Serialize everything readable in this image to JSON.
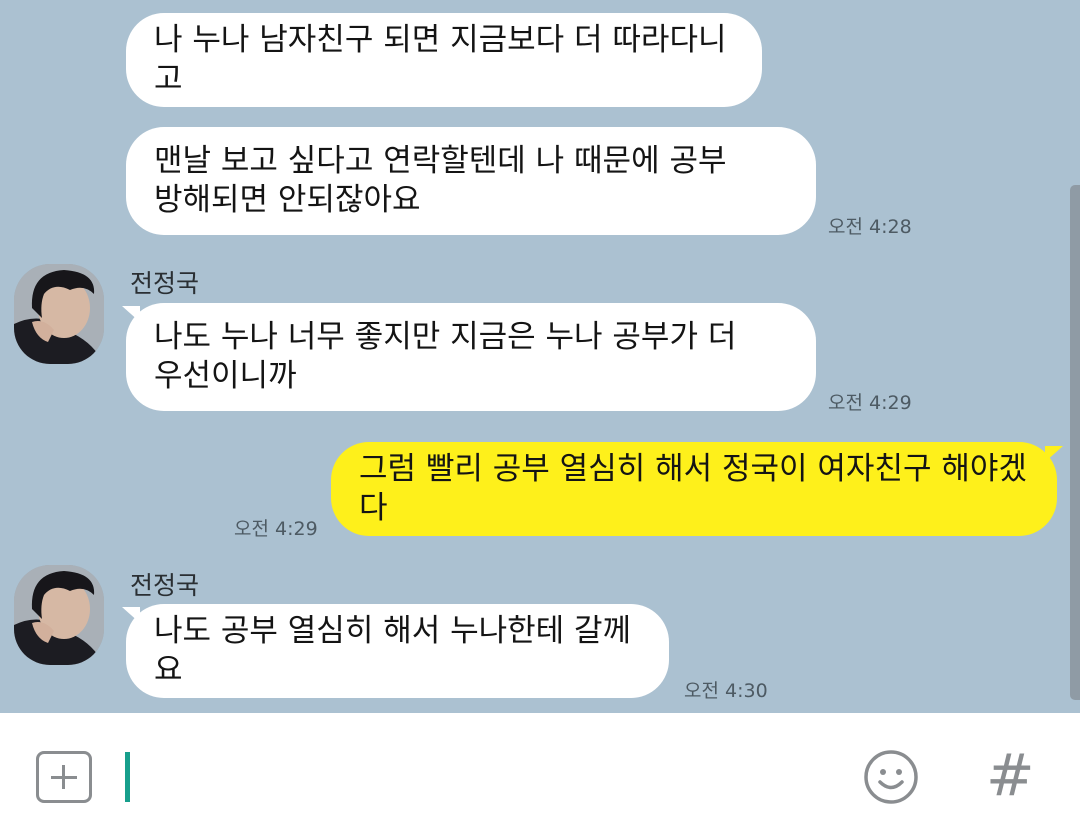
{
  "messages": [
    {
      "text": "나 누나 남자친구 되면 지금보다 더 따라다니고"
    },
    {
      "text": "맨날 보고 싶다고 연락할텐데 나 때문에 공부\n방해되면 안되잖아요",
      "time": "오전 4:28"
    },
    {
      "sender": "전정국",
      "text": "나도 누나 너무 좋지만 지금은 누나 공부가 더\n우선이니까",
      "time": "오전 4:29"
    },
    {
      "text": "그럼 빨리 공부 열심히 해서 정국이 여자친구 해야겠다",
      "time": "오전 4:29"
    },
    {
      "sender": "전정국",
      "text": "나도 공부 열심히 해서 누나한테 갈께요",
      "time": "오전 4:30"
    }
  ],
  "composer": {
    "icons": [
      "plus-icon",
      "emoji-icon",
      "hash-icon"
    ],
    "hash_glyph": "#"
  },
  "colors": {
    "background": "#abc1d1",
    "my_bubble": "#fef01b",
    "other_bubble": "#ffffff",
    "caret": "#179f8c"
  }
}
